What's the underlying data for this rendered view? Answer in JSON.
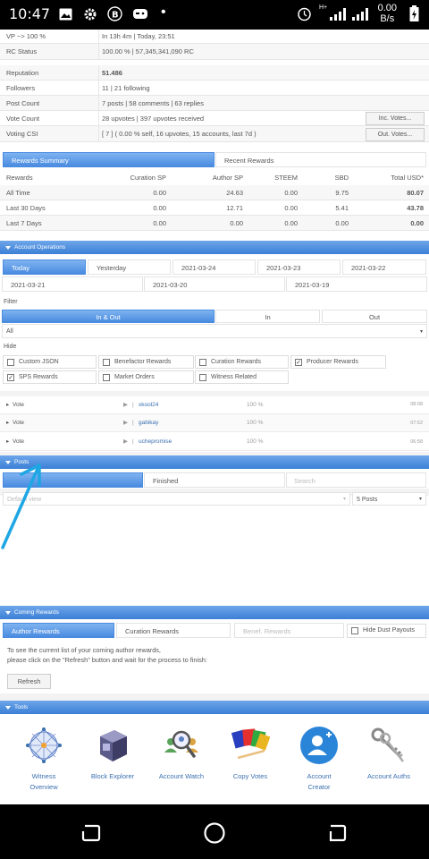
{
  "status_bar": {
    "time": "10:47",
    "net_speed": "0.00",
    "net_unit": "B/s",
    "carrier_tag": "H+"
  },
  "account": {
    "vp_label": "VP ~> 100 %",
    "vp_value": "In 13h 4m  |  Today, 23:51",
    "rc_label": "RC Status",
    "rc_value": "100.00 %  |  57,345,341,090 RC",
    "reputation_label": "Reputation",
    "reputation_value": "51.486",
    "followers_label": "Followers",
    "followers_value": "11  |  21 following",
    "post_count_label": "Post Count",
    "post_count_value": "7 posts  |  58 comments  |  63 replies",
    "vote_count_label": "Vote Count",
    "vote_count_value": "28 upvotes  |  397 upvotes received",
    "inc_votes_label": "Inc. Votes...",
    "voting_csi_label": "Voting CSI",
    "voting_csi_value": "[ 7 ] ( 0.00 % self, 16 upvotes, 15 accounts, last 7d )",
    "out_votes_label": "Out. Votes..."
  },
  "rewards": {
    "tabs": [
      "Rewards Summary",
      "Recent Rewards"
    ],
    "headers": [
      "Rewards",
      "Curation SP",
      "Author SP",
      "STEEM",
      "SBD",
      "Total USD*"
    ],
    "rows": [
      [
        "All Time",
        "0.00",
        "24.63",
        "0.00",
        "9.75",
        "80.07"
      ],
      [
        "Last 30 Days",
        "0.00",
        "12.71",
        "0.00",
        "5.41",
        "43.78"
      ],
      [
        "Last 7 Days",
        "0.00",
        "0.00",
        "0.00",
        "0.00",
        "0.00"
      ]
    ]
  },
  "account_operations": {
    "title": "Account Operations",
    "dates_row1": [
      "Today",
      "Yesterday",
      "2021-03-24",
      "2021-03-23",
      "2021-03-22"
    ],
    "dates_row2": [
      "2021-03-21",
      "2021-03-20",
      "2021-03-19"
    ],
    "filter_label": "Filter",
    "filter_tabs": [
      "In & Out",
      "In",
      "Out"
    ],
    "select_value": "All",
    "hide_label": "Hide",
    "hide_options": [
      {
        "label": "Custom JSON",
        "checked": false
      },
      {
        "label": "Benefactor Rewards",
        "checked": false
      },
      {
        "label": "Curation Rewards",
        "checked": false
      },
      {
        "label": "Producer Rewards",
        "checked": true
      },
      {
        "label": "SPS Rewards",
        "checked": true
      },
      {
        "label": "Market Orders",
        "checked": false
      },
      {
        "label": "Witness Related",
        "checked": false
      }
    ],
    "votes": [
      {
        "type": "Vote",
        "user": "xkool24",
        "pct": "100 %",
        "time": "08:08"
      },
      {
        "type": "Vote",
        "user": "gabikay",
        "pct": "100 %",
        "time": "07:52"
      },
      {
        "type": "Vote",
        "user": "uchepromise",
        "pct": "100 %",
        "time": "06:58"
      }
    ]
  },
  "posts": {
    "title": "Posts",
    "tabs": [
      "",
      "Finished"
    ],
    "search_placeholder": "Search",
    "sort_value": "Default view",
    "count_value": "5 Posts"
  },
  "coming_rewards": {
    "title": "Coming Rewards",
    "tabs": [
      "Author Rewards",
      "Curation Rewards",
      "Benef. Rewards"
    ],
    "hide_dust_label": "Hide Dust Payouts",
    "info_line1": "To see the current list of your coming author rewards,",
    "info_line2": "please click on the \"Refresh\" button and wait for the process to finish:",
    "refresh_label": "Refresh"
  },
  "tools": {
    "title": "Tools",
    "items": [
      {
        "label1": "Witness",
        "label2": "Overview",
        "icon": "network-globe-icon"
      },
      {
        "label1": "Block Explorer",
        "label2": "",
        "icon": "cube-icon"
      },
      {
        "label1": "Account Watch",
        "label2": "",
        "icon": "magnifier-people-icon"
      },
      {
        "label1": "Copy Votes",
        "label2": "",
        "icon": "cards-icon"
      },
      {
        "label1": "Account",
        "label2": "Creator",
        "icon": "add-user-icon"
      },
      {
        "label1": "Account Auths",
        "label2": "",
        "icon": "keys-icon"
      }
    ]
  },
  "colors": {
    "accent": "#3b7fd6",
    "arrow": "#1ea7e4",
    "link": "#3a6fb0"
  }
}
